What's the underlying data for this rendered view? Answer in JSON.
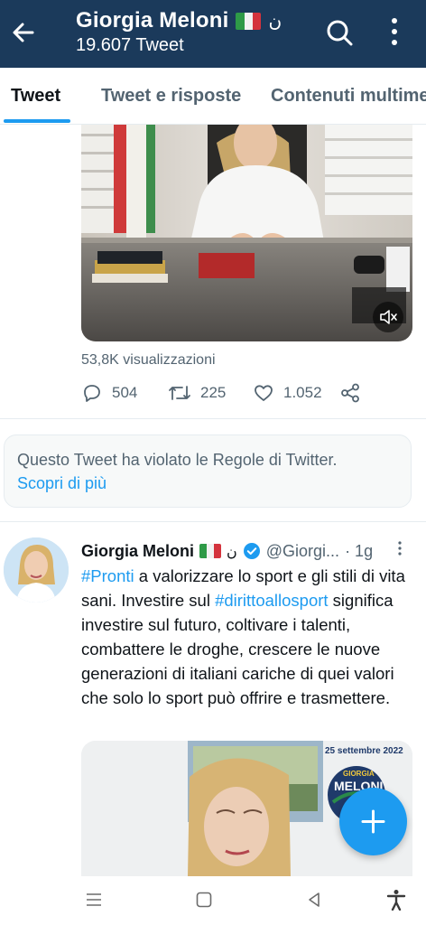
{
  "header": {
    "title": "Giorgia Meloni",
    "title_suffix": "ن",
    "subtitle": "19.607 Tweet",
    "background": "#1b3a5b",
    "icons": [
      "back-arrow-icon",
      "italian-flag-icon",
      "search-icon",
      "more-vertical-icon"
    ]
  },
  "tabs": [
    {
      "label": "Tweet",
      "active": true
    },
    {
      "label": "Tweet e risposte",
      "active": false
    },
    {
      "label": "Contenuti multimediali",
      "active": false
    }
  ],
  "tweet1": {
    "views": "53,8K visualizzazioni",
    "replies": "504",
    "retweets": "225",
    "likes": "1.052",
    "media_icons": [
      "mute-icon"
    ]
  },
  "notice": {
    "text": "Questo Tweet ha violato le Regole di Twitter.",
    "link": "Scopri di più"
  },
  "tweet2": {
    "name": "Giorgia Meloni",
    "name_suffix": "ن",
    "handle": "@Giorgi...",
    "time": "· 1g",
    "body_hashtag1": "#Pronti",
    "body_part1": " a valorizzare lo sport e gli stili di vita sani. Investire sul ",
    "body_hashtag2": "#dirittoallosport",
    "body_part2": " significa investire sul futuro, coltivare i talenti, combattere le droghe, crescere le nuove generazioni di italiani cariche di quei valori che solo lo sport può offrire e trasmettere.",
    "poster_date": "25 settembre 2022",
    "poster_brand_top": "GIORGIA",
    "poster_brand": "MELONI"
  },
  "colors": {
    "accent": "#1d9bf0",
    "muted": "#536471",
    "text": "#0f1419"
  },
  "fab": {
    "icon": "plus-icon"
  },
  "system_nav": [
    "recents-icon",
    "home-icon",
    "back-icon",
    "accessibility-icon"
  ]
}
